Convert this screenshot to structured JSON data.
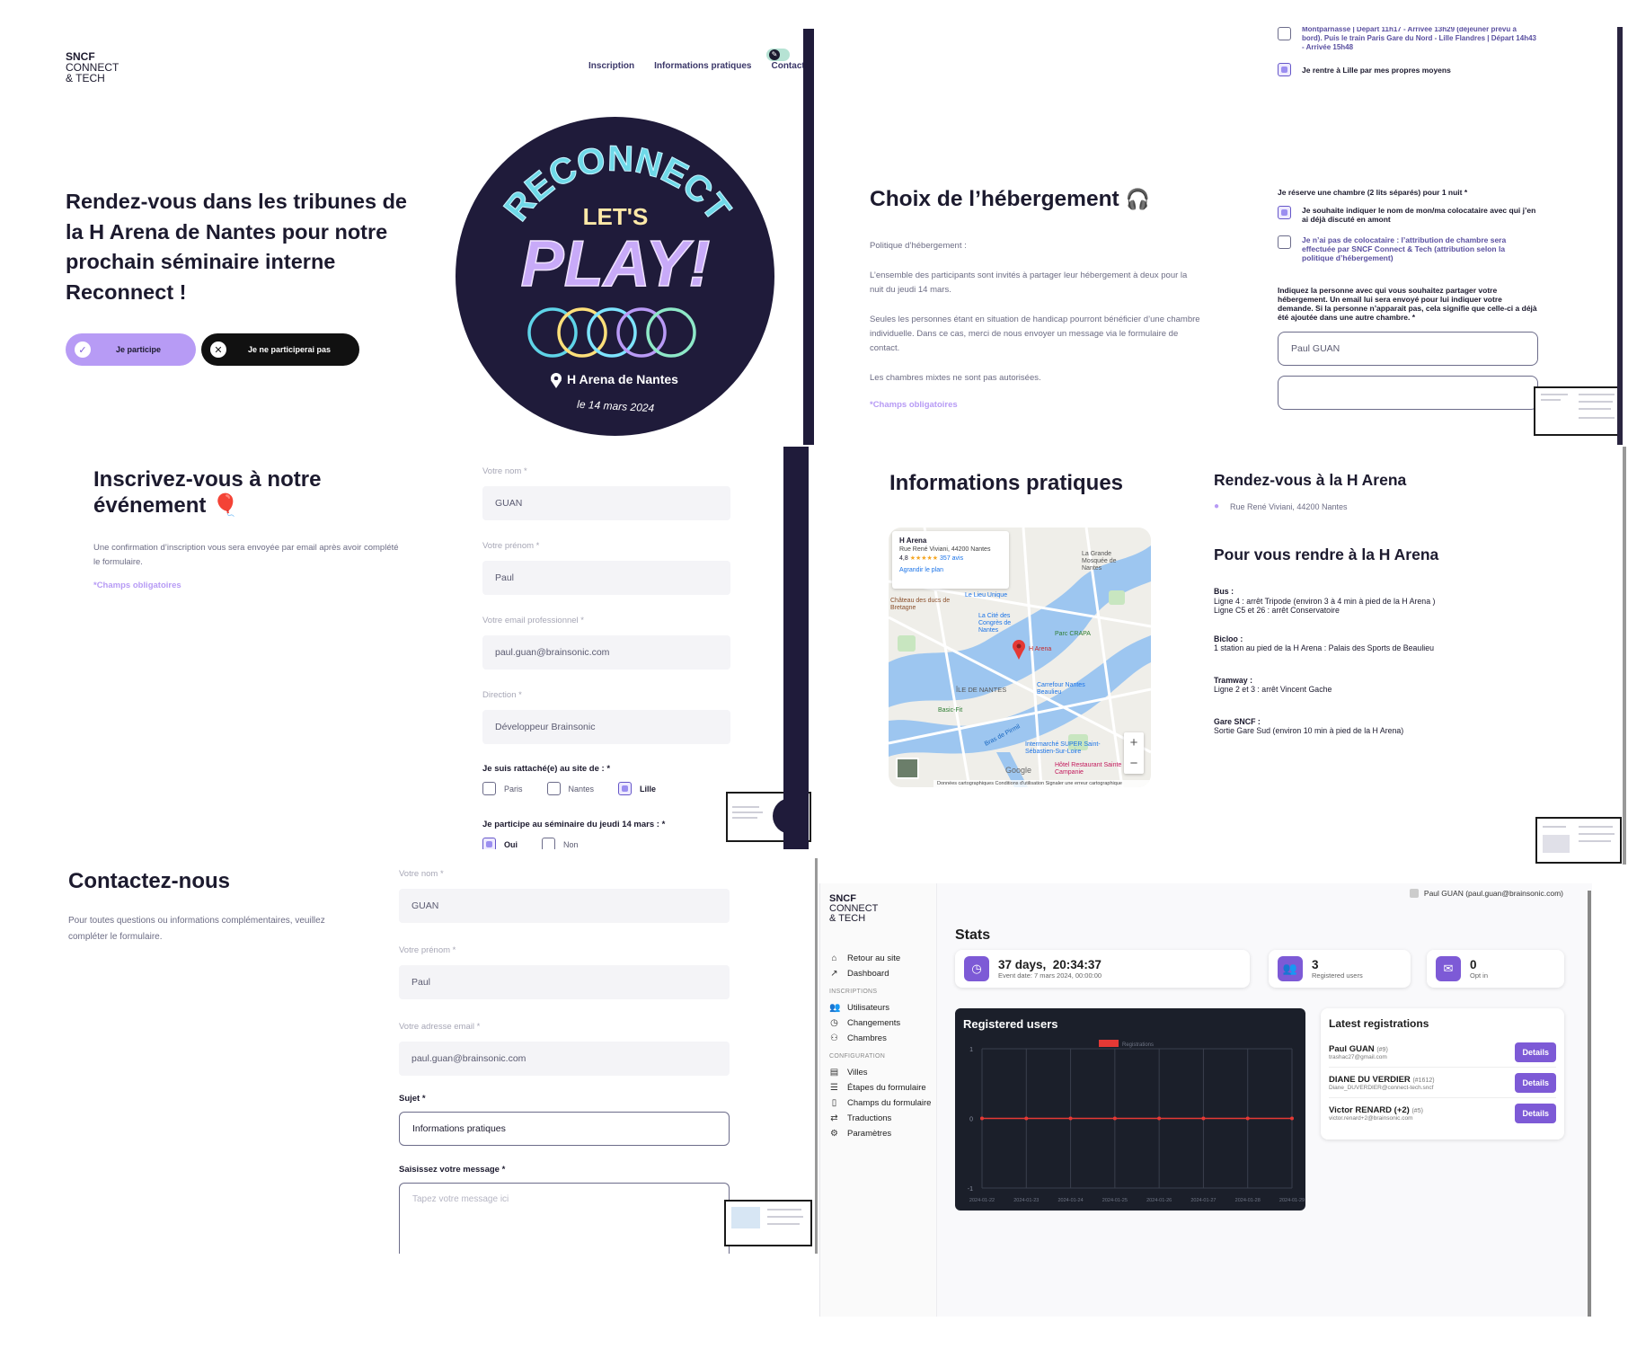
{
  "colors": {
    "purple": "#a78bfa",
    "accent": "#7d5ad6",
    "dark": "#1f1b3a",
    "chart_line": "#e53935"
  },
  "logo": {
    "line1": "SNCF",
    "line2": "CONNECT",
    "line3": "& TECH"
  },
  "home": {
    "nav": [
      "Inscription",
      "Informations pratiques",
      "Contact"
    ],
    "headline": "Rendez-vous dans les tribunes de la H Arena de Nantes pour notre prochain séminaire interne Reconnect !",
    "btn_yes": "Je participe",
    "btn_no": "Je ne participerai pas",
    "poster": {
      "arc": "RECONNECT",
      "lets": "LET'S",
      "play": "PLAY!",
      "place": "H Arena de Nantes",
      "date": "le 14 mars 2024"
    }
  },
  "hebergement": {
    "top_partial": "Montparnasse | Départ 11h17 - Arrivée 13h29 (déjeuner prévu à bord). Puis le train Paris Gare du Nord - Lille Flandres | Départ 14h43 - Arrivée 15h48",
    "own_means": "Je rentre à Lille par mes propres moyens",
    "title": "Choix de l’hébergement",
    "policy_label": "Politique d’hébergement :",
    "p1": "L’ensemble des participants sont invités à partager leur hébergement à deux pour la nuit du jeudi 14 mars.",
    "p2": "Seules les personnes étant en situation de handicap pourront bénéficier d’une chambre individuelle. Dans ce cas, merci de nous envoyer un message via le formulaire de contact.",
    "p3": "Les chambres mixtes ne sont pas autorisées.",
    "required": "*Champs obligatoires",
    "room_q": "Je réserve une chambre (2 lits séparés) pour 1 nuit *",
    "opt1": "Je souhaite indiquer le nom de mon/ma colocataire avec qui j’en ai déjà discuté en amont",
    "opt2": "Je n’ai pas de colocataire : l’attribution de chambre sera effectuée par SNCF Connect & Tech (attribution selon la politique d’hébergement)",
    "indicate": "Indiquez la personne avec qui vous souhaitez partager votre hébergement. Un email lui sera envoyé pour lui indiquer votre demande. Si la personne n’apparait pas, cela signifie que celle-ci a déjà été ajoutée dans une autre chambre. *",
    "roommate": "Paul GUAN"
  },
  "inscription": {
    "title1": "Inscrivez-vous à notre",
    "title2": "événement",
    "desc": "Une confirmation d’inscription vous sera envoyée par email après avoir complété le formulaire.",
    "required": "*Champs obligatoires",
    "f_nom": "Votre nom *",
    "v_nom": "GUAN",
    "f_prenom": "Votre prénom *",
    "v_prenom": "Paul",
    "f_email": "Votre email professionnel *",
    "v_email": "paul.guan@brainsonic.com",
    "f_direction": "Direction *",
    "v_direction": "Développeur Brainsonic",
    "site_q": "Je suis rattaché(e) au site de : *",
    "sites": [
      "Paris",
      "Nantes",
      "Lille"
    ],
    "sem_q": "Je participe au séminaire du jeudi 14 mars : *",
    "sem_opts": [
      "Oui",
      "Non"
    ]
  },
  "infos": {
    "title": "Informations pratiques",
    "map_place": "H Arena",
    "map_addr": "Rue René Viviani, 44200 Nantes",
    "map_rating": "4,8",
    "map_stars": "★★★★★",
    "map_reviews": "357 avis",
    "map_enlarge": "Agrandir le plan",
    "map_labels": [
      "La Grande Mosquée de Nantes",
      "Château des ducs de Bretagne",
      "Le Lieu Unique",
      "La Cité des Congrès de Nantes",
      "Parc CRAPA",
      "H Arena",
      "ÎLE DE NANTES",
      "Carrefour Nantes Beaulieu",
      "Basic-Fit",
      "Intermarché SUPER Saint-Sébastien-Sur-Loire",
      "Hôtel Restaurant Sainte Campanie",
      "Bras de Pirmil",
      "Google"
    ],
    "map_footer": "Données cartographiques   Conditions d'utilisation   Signaler une erreur cartographique",
    "rdv_title": "Rendez-vous à la H Arena",
    "rdv_addr": "Rue René Viviani, 44200 Nantes",
    "go_title": "Pour vous rendre à la H Arena",
    "bus_t": "Bus :",
    "bus_1": "Ligne 4 : arrêt Tripode (environ 3 à 4 min à pied de la H Arena )",
    "bus_2": "Ligne C5 et 26 : arrêt Conservatoire",
    "bicloo_t": "Bicloo :",
    "bicloo_1": "1 station au pied de la H Arena : Palais des Sports de Beaulieu",
    "tram_t": "Tramway :",
    "tram_1": "Ligne 2 et 3 : arrêt Vincent Gache",
    "gare_t": "Gare SNCF :",
    "gare_1": "Sortie Gare Sud (environ 10 min à pied de la H Arena)"
  },
  "contact": {
    "title": "Contactez-nous",
    "desc": "Pour toutes questions ou informations complémentaires, veuillez compléter le formulaire.",
    "f_nom": "Votre nom *",
    "v_nom": "GUAN",
    "f_prenom": "Votre prénom *",
    "v_prenom": "Paul",
    "f_email": "Votre adresse email *",
    "v_email": "paul.guan@brainsonic.com",
    "f_sujet": "Sujet *",
    "v_sujet": "Informations pratiques",
    "f_msg": "Saisissez votre message *",
    "msg_placeholder": "Tapez votre message ici"
  },
  "admin": {
    "user": "Paul GUAN (paul.guan@brainsonic.com)",
    "nav_top": [
      "Retour au site",
      "Dashboard"
    ],
    "sec_inscriptions": "INSCRIPTIONS",
    "nav_inscriptions": [
      "Utilisateurs",
      "Changements",
      "Chambres"
    ],
    "sec_configuration": "CONFIGURATION",
    "nav_configuration": [
      "Villes",
      "Étapes du formulaire",
      "Champs du formulaire",
      "Traductions",
      "Paramètres"
    ],
    "title": "Stats",
    "countdown": "37 days,  20:34:37",
    "event_date": "Event date: 7 mars 2024, 00:00:00",
    "registered": "3",
    "registered_label": "Registered users",
    "optin": "0",
    "optin_label": "Opt in",
    "chart_title": "Registered users",
    "latest_title": "Latest registrations",
    "latest": [
      {
        "name": "Paul GUAN",
        "id": "(#9)",
        "email": "trashac27@gmail.com",
        "btn": "Details"
      },
      {
        "name": "DIANE DU VERDIER",
        "id": "(#1612)",
        "email": "Diane_DUVERDIER@connect-tech.sncf",
        "btn": "Details"
      },
      {
        "name": "Victor RENARD (+2)",
        "id": "(#5)",
        "email": "victor.renard+2@brainsonic.com",
        "btn": "Details"
      }
    ]
  },
  "chart_data": {
    "type": "line",
    "title": "Registered users",
    "x": [
      "2024-01-22",
      "2024-01-23",
      "2024-01-24",
      "2024-01-25",
      "2024-01-26",
      "2024-01-27",
      "2024-01-28",
      "2024-01-29"
    ],
    "series": [
      {
        "name": "Registrations",
        "values": [
          0,
          0,
          0,
          0,
          0,
          0,
          0,
          0
        ]
      }
    ],
    "ylim": [
      -1,
      1
    ],
    "yticks": [
      "1",
      "0",
      "-1"
    ],
    "grid": true,
    "legend": "top"
  }
}
